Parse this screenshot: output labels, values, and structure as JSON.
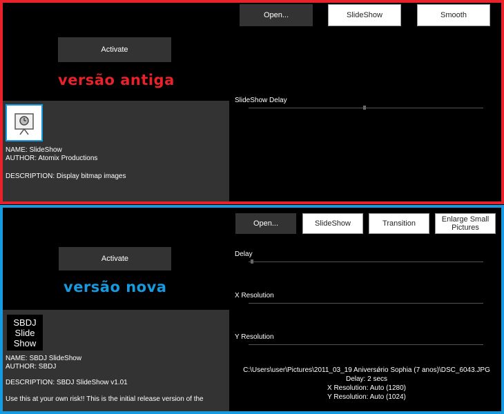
{
  "old_version": {
    "caption": "versão antiga",
    "caption_color": "#e8212b",
    "frame_color": "#e8212b",
    "buttons": {
      "open": "Open...",
      "slideshow": "SlideShow",
      "smooth": "Smooth"
    },
    "activate": "Activate",
    "plugin_icon": "slideshow-projector-icon",
    "name_line": "NAME: SlideShow",
    "author_line": "AUTHOR: Atomix Productions",
    "description_line": "DESCRIPTION: Display bitmap images",
    "delay_label": "SlideShow Delay"
  },
  "new_version": {
    "caption": "versão nova",
    "caption_color": "#169ae0",
    "frame_color": "#169ae0",
    "buttons": {
      "open": "Open...",
      "slideshow": "SlideShow",
      "transition": "Transition",
      "enlarge_line1": "Enlarge Small",
      "enlarge_line2": "Pictures"
    },
    "activate": "Activate",
    "logo_lines": [
      "SBDJ",
      "Slide",
      "Show"
    ],
    "name_line": "NAME: SBDJ SlideShow",
    "author_line": "AUTHOR: SBDJ",
    "description_line": "DESCRIPTION: SBDJ SlideShow v1.01",
    "notice_line": "Use this at your own risk!! This is the initial release version of the",
    "sliders": {
      "delay": "Delay",
      "x_resolution": "X Resolution",
      "y_resolution": "Y Resolution"
    },
    "status": {
      "path": "C:\\Users\\user\\Pictures\\2011_03_19 Aniversǿrio Sophia (7 anos)\\DSC_6043.JPG",
      "delay": "Delay: 2 secs",
      "x_res": "X Resolution: Auto (1280)",
      "y_res": "Y Resolution: Auto (1024)"
    }
  }
}
